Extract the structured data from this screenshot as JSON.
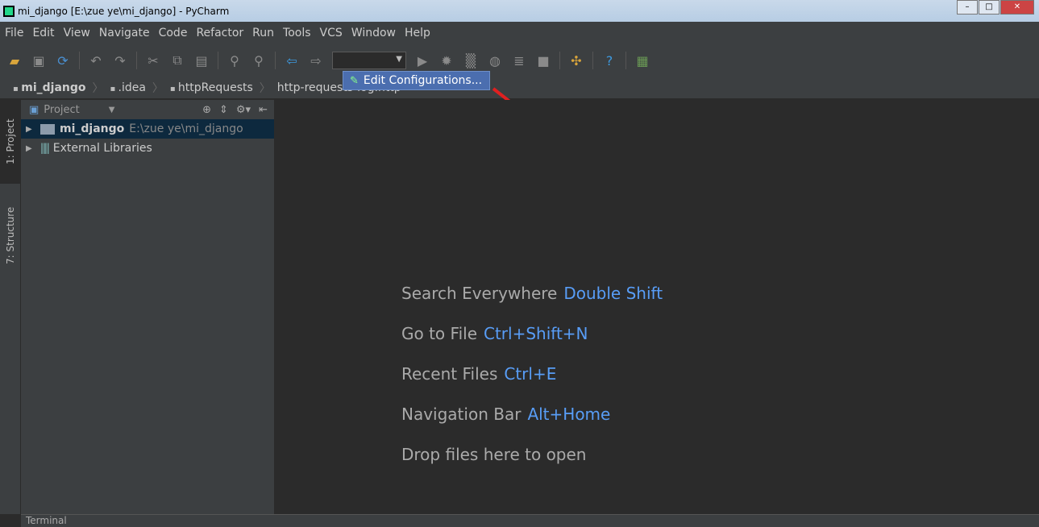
{
  "window": {
    "title": "mi_django [E:\\zue ye\\mi_django] - PyCharm"
  },
  "menu": [
    "File",
    "Edit",
    "View",
    "Navigate",
    "Code",
    "Refactor",
    "Run",
    "Tools",
    "VCS",
    "Window",
    "Help"
  ],
  "breadcrumb": [
    "mi_django",
    ".idea",
    "httpRequests",
    "http-requests-log.http"
  ],
  "popup": {
    "label": "Edit Configurations..."
  },
  "side_tabs": {
    "project": "1: Project",
    "structure": "7: Structure"
  },
  "project_panel": {
    "title": "Project",
    "root": {
      "name": "mi_django",
      "path": "E:\\zue ye\\mi_django"
    },
    "libs": "External Libraries"
  },
  "hints": [
    {
      "label": "Search Everywhere",
      "key": "Double Shift"
    },
    {
      "label": "Go to File",
      "key": "Ctrl+Shift+N"
    },
    {
      "label": "Recent Files",
      "key": "Ctrl+E"
    },
    {
      "label": "Navigation Bar",
      "key": "Alt+Home"
    },
    {
      "label": "Drop files here to open",
      "key": ""
    }
  ],
  "bottom": {
    "terminal": "Terminal"
  }
}
